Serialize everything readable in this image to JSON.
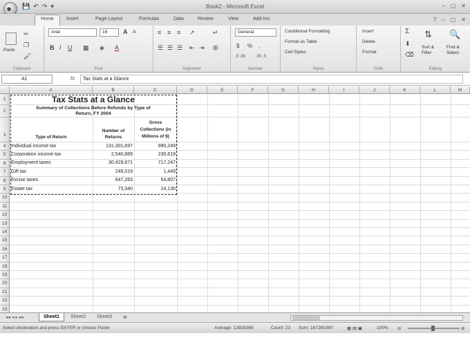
{
  "window": {
    "title": "Book2 - Microsoft Excel",
    "office_button": "Office",
    "qat": [
      "💾",
      "↶",
      "↷",
      "▾"
    ],
    "controls": [
      "–",
      "▢",
      "✕"
    ]
  },
  "tabs": [
    "Home",
    "Insert",
    "Page Layout",
    "Formulas",
    "Data",
    "Review",
    "View",
    "Add-Ins"
  ],
  "ribbon": {
    "clipboard": {
      "label": "Clipboard",
      "paste": "Paste"
    },
    "font": {
      "label": "Font",
      "name": "Arial",
      "size": "16",
      "grow": "A",
      "shrink": "A",
      "bold": "B",
      "italic": "I",
      "underline": "U"
    },
    "alignment": {
      "label": "Alignment"
    },
    "number": {
      "label": "Number",
      "format": "General",
      "currency": "$",
      "percent": "%",
      "comma": ",",
      "inc": ".0 .00",
      "dec": ".00 .0"
    },
    "styles": {
      "label": "Styles",
      "conditional": "Conditional Formatting",
      "table": "Format as Table",
      "cell_styles": "Cell Styles"
    },
    "cells": {
      "label": "Cells",
      "insert": "Insert",
      "delete": "Delete",
      "format": "Format"
    },
    "editing": {
      "label": "Editing",
      "sum": "Σ",
      "sort": "Sort &",
      "filter": "Filter",
      "find": "Find &",
      "select": "Select"
    }
  },
  "formula_bar": {
    "name_box": "A1",
    "fx": "fx",
    "formula": "Tax Stats at a Glance"
  },
  "columns": [
    "A",
    "B",
    "C",
    "D",
    "E",
    "F",
    "G",
    "H",
    "I",
    "J",
    "K",
    "L",
    "M"
  ],
  "rows": [
    "1",
    "2",
    "3",
    "4",
    "5",
    "6",
    "7",
    "8",
    "9",
    "10",
    "11",
    "12",
    "13",
    "14",
    "15",
    "16",
    "17",
    "18",
    "19",
    "20",
    "21",
    "22",
    "23"
  ],
  "sheet": {
    "title": "Tax Stats at a Glance",
    "subtitle_line1": "Summary of Collections Before Refunds by Type of",
    "subtitle_line2": "Return, FY 2004",
    "headers": {
      "type": "Type of Return",
      "number_line1": "Number of",
      "number_line2": "Returns",
      "gross_line1": "Gross",
      "gross_line2": "Collections (in",
      "gross_line3": "Millions of $)"
    },
    "data": [
      {
        "type": "Individual income tax",
        "number": "131,301,697",
        "gross": "990,249"
      },
      {
        "type": "Corporation income tax",
        "number": "2,540,889",
        "gross": "230,619"
      },
      {
        "type": "Employment taxes",
        "number": "30,429,671",
        "gross": "717,247"
      },
      {
        "type": "Gift tax",
        "number": "249,019",
        "gross": "1,449"
      },
      {
        "type": "Excise taxes",
        "number": "647,263",
        "gross": "54,807"
      },
      {
        "type": "Estate tax",
        "number": "73,340",
        "gross": "24,130"
      }
    ]
  },
  "sheet_tabs": [
    "Sheet1",
    "Sheet2",
    "Sheet3"
  ],
  "status": {
    "message": "Select destination and press ENTER or choose Paste",
    "average": "Average: 13938365",
    "count": "Count: 23",
    "sum": "Sum: 167260380",
    "zoom": "100%"
  }
}
